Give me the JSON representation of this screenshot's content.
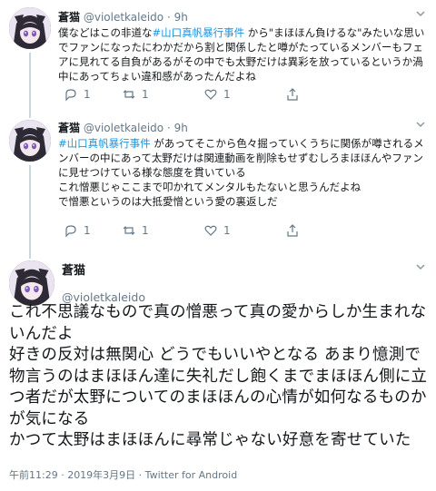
{
  "thread": [
    {
      "name": "蒼猫",
      "handle": "@violetkaleido",
      "dot": "·",
      "time": "9h",
      "text_segments": [
        {
          "text": "僕などはこの非道な",
          "hashtag": false
        },
        {
          "text": "#山口真帆暴行事件",
          "hashtag": true
        },
        {
          "text": " から\"まほほん負けるな\"みたいな思いでファンになったにわかだから割と関係したと噂がたっているメンバーもフェアに見れてる自負があるがその中でも太野だけは異彩を放っているというか渦中にあってちょい違和感があったんだよね",
          "hashtag": false
        }
      ],
      "replies": "1",
      "retweets": "1",
      "likes": "1"
    },
    {
      "name": "蒼猫",
      "handle": "@violetkaleido",
      "dot": "·",
      "time": "9h",
      "text_segments": [
        {
          "text": "#山口真帆暴行事件",
          "hashtag": true
        },
        {
          "text": " があってそこから色々掘っていくうちに関係が噂されるメンバーの中にあって太野だけは関連動画を削除もせずむしろまほほんやファンに見せつけている様な態度を貫いている\nこれ憎悪じゃここまで叩かれてメンタルもたないと思うんだよね\nで憎悪というのは大抵愛憎という愛の裏返しだ",
          "hashtag": false
        }
      ],
      "replies": "1",
      "retweets": "1",
      "likes": "1"
    }
  ],
  "main": {
    "name": "蒼猫",
    "handle": "@violetkaleido",
    "paragraphs": [
      "これ不思議なもので真の憎悪って真の愛からしか生まれないんだよ",
      "好きの反対は無関心 どうでもいいやとなる あまり憶測で物言うのはまほほん達に失礼だし飽くまでまほほん側に立つ者だが太野についてのまほほんの心情が如何なるものかが気になる",
      "かつて太野はまほほんに尋常じゃない好意を寄せていた"
    ],
    "meta": "午前11:29 · 2019年3月9日 · Twitter for Android"
  },
  "icons": {
    "avatar": "anime-cat-avatar",
    "reply": "reply-icon",
    "retweet": "retweet-icon",
    "like": "heart-icon",
    "share": "share-icon",
    "more": "chevron-down-icon"
  },
  "colors": {
    "hashtag": "#1b95e0",
    "secondary_text": "#657786",
    "divider": "#e6ecf0",
    "thread_line": "#ccd6dd"
  }
}
